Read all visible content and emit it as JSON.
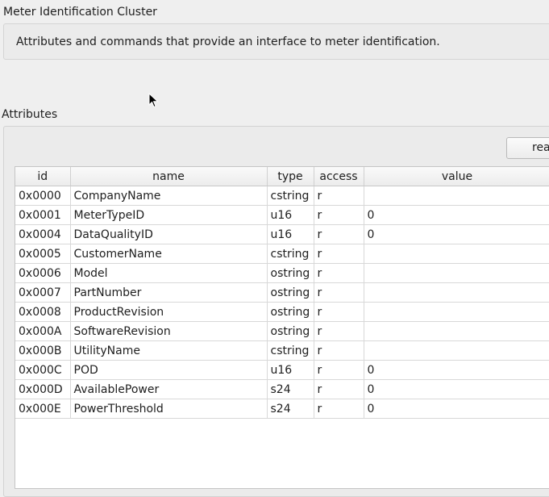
{
  "cluster": {
    "title": "Meter Identification Cluster",
    "description": "Attributes and commands that provide an interface to meter identification."
  },
  "attributes": {
    "label": "Attributes",
    "read_button": "read",
    "columns": [
      "id",
      "name",
      "type",
      "access",
      "value"
    ],
    "rows": [
      [
        "0x0000",
        "CompanyName",
        "cstring",
        "r",
        ""
      ],
      [
        "0x0001",
        "MeterTypeID",
        "u16",
        "r",
        "0"
      ],
      [
        "0x0004",
        "DataQualityID",
        "u16",
        "r",
        "0"
      ],
      [
        "0x0005",
        "CustomerName",
        "cstring",
        "r",
        ""
      ],
      [
        "0x0006",
        "Model",
        "ostring",
        "r",
        ""
      ],
      [
        "0x0007",
        "PartNumber",
        "ostring",
        "r",
        ""
      ],
      [
        "0x0008",
        "ProductRevision",
        "ostring",
        "r",
        ""
      ],
      [
        "0x000A",
        "SoftwareRevision",
        "ostring",
        "r",
        ""
      ],
      [
        "0x000B",
        "UtilityName",
        "cstring",
        "r",
        ""
      ],
      [
        "0x000C",
        "POD",
        "u16",
        "r",
        "0"
      ],
      [
        "0x000D",
        "AvailablePower",
        "s24",
        "r",
        "0"
      ],
      [
        "0x000E",
        "PowerThreshold",
        "s24",
        "r",
        "0"
      ]
    ]
  }
}
